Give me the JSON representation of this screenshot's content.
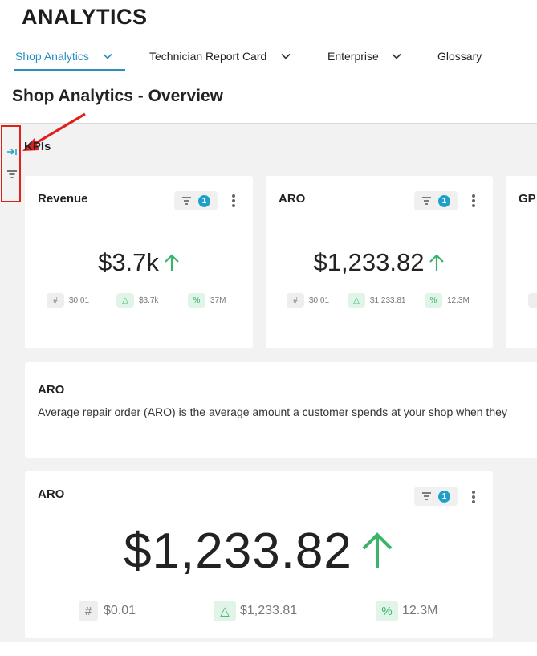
{
  "app": {
    "title": "ANALYTICS"
  },
  "nav": {
    "tabs": [
      {
        "label": "Shop Analytics",
        "active": true,
        "has_dropdown": true
      },
      {
        "label": "Technician Report Card",
        "active": false,
        "has_dropdown": true
      },
      {
        "label": "Enterprise",
        "active": false,
        "has_dropdown": true
      },
      {
        "label": "Glossary",
        "active": false,
        "has_dropdown": false
      }
    ]
  },
  "page": {
    "title": "Shop Analytics - Overview"
  },
  "side_rail": {
    "icons": [
      "expand-panel-icon",
      "filter-icon"
    ]
  },
  "kpis": {
    "section_label": "KPIs",
    "cards": [
      {
        "title": "Revenue",
        "filter_count": "1",
        "value": "$3.7k",
        "trend": "up",
        "stats": {
          "count": "$0.01",
          "change": "$3.7k",
          "percent": "37M"
        }
      },
      {
        "title": "ARO",
        "filter_count": "1",
        "value": "$1,233.82",
        "trend": "up",
        "stats": {
          "count": "$0.01",
          "change": "$1,233.81",
          "percent": "12.3M"
        }
      },
      {
        "title": "GP"
      }
    ]
  },
  "description": {
    "title": "ARO",
    "text": "Average repair order (ARO) is the average amount a customer spends at your shop when they"
  },
  "detail_card": {
    "title": "ARO",
    "filter_count": "1",
    "value": "$1,233.82",
    "trend": "up",
    "stats": {
      "count": "$0.01",
      "change": "$1,233.81",
      "percent": "12.3M"
    }
  },
  "colors": {
    "accent": "#2a8fbd",
    "trend_up": "#3bb36b",
    "badge": "#1f9fc8",
    "annotation": "#e0201c"
  }
}
